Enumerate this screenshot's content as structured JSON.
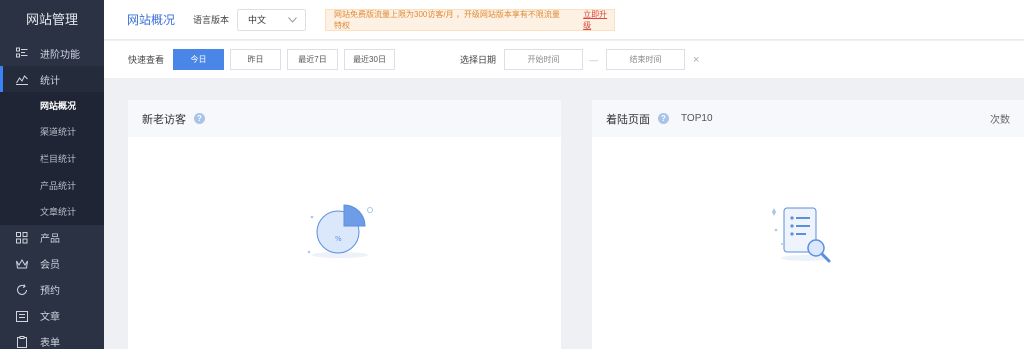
{
  "sidebar": {
    "brand": "网站管理",
    "items": [
      {
        "label": "进阶功能",
        "icon": "list-icon"
      },
      {
        "label": "统计",
        "icon": "chart-line-icon"
      },
      {
        "label": "产品",
        "icon": "grid-icon"
      },
      {
        "label": "会员",
        "icon": "crown-icon"
      },
      {
        "label": "预约",
        "icon": "refresh-icon"
      },
      {
        "label": "文章",
        "icon": "calendar-icon"
      },
      {
        "label": "表单",
        "icon": "clipboard-icon"
      }
    ],
    "sub_items": [
      {
        "label": "网站概况",
        "selected": true
      },
      {
        "label": "渠道统计"
      },
      {
        "label": "栏目统计"
      },
      {
        "label": "产品统计"
      },
      {
        "label": "文章统计"
      }
    ]
  },
  "topbar": {
    "page_title": "网站概况",
    "lang_label": "语言版本",
    "lang_value": "中文",
    "notice_text": "网站免费版流量上限为300访客/月 ，开级网站版本享有不限流量特权",
    "notice_link": "立即升级"
  },
  "filters": {
    "quick_label": "快速查看",
    "quick_buttons": [
      "今日",
      "昨日",
      "最近7日",
      "最近30日"
    ],
    "date_label": "选择日期",
    "start_placeholder": "开始时间",
    "range_sep": "—",
    "end_placeholder": "结束时间",
    "clear_glyph": "×"
  },
  "panels": {
    "visitors": {
      "title": "新老访客",
      "help": "?",
      "pie_label": "%"
    },
    "pages": {
      "title": "着陆页面",
      "help": "?",
      "tag": "TOP10",
      "count_label": "次数"
    }
  },
  "colors": {
    "accent": "#4a86e8",
    "sidebar": "#2a3244"
  }
}
